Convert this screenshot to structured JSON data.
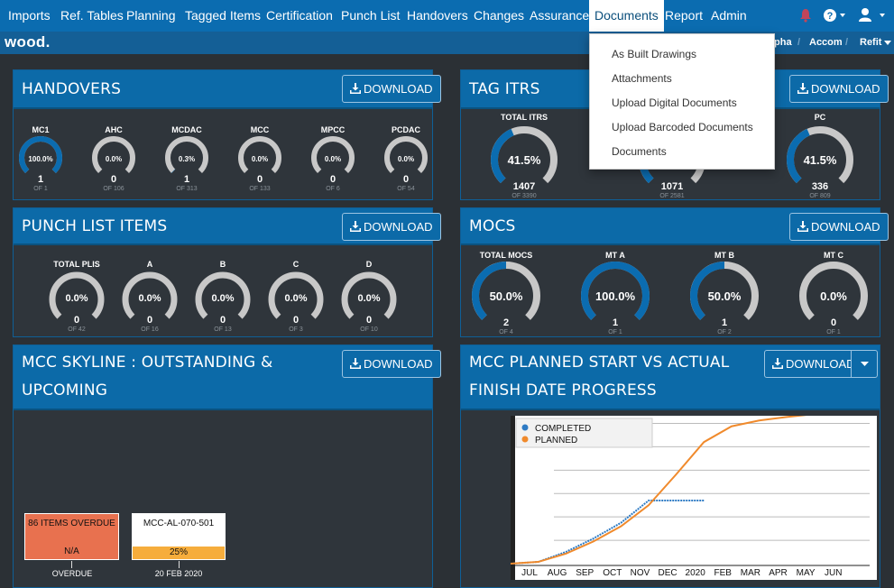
{
  "nav": {
    "items": [
      "Imports",
      "Ref. Tables",
      "Planning",
      "Tagged Items",
      "Certification",
      "Punch List",
      "Handovers",
      "Changes",
      "Assurance",
      "Documents",
      "Report",
      "Admin"
    ],
    "active": "Documents"
  },
  "subbar": {
    "logo": "wood.",
    "crumbs": [
      "pha",
      "Accom",
      "Refit"
    ]
  },
  "dropdown": {
    "items": [
      "As Built Drawings",
      "Attachments",
      "Upload Digital Documents",
      "Upload Barcoded Documents",
      "Documents"
    ]
  },
  "download_label": "DOWNLOAD",
  "panels": {
    "handovers": {
      "title": "HANDOVERS",
      "gauges": [
        {
          "label": "MC1",
          "pct": "100.0%",
          "value": 1.0,
          "count": "1",
          "of": "OF 1"
        },
        {
          "label": "AHC",
          "pct": "0.0%",
          "value": 0,
          "count": "0",
          "of": "OF 106"
        },
        {
          "label": "MCDAC",
          "pct": "0.3%",
          "value": 0.003,
          "count": "1",
          "of": "OF 313"
        },
        {
          "label": "MCC",
          "pct": "0.0%",
          "value": 0,
          "count": "0",
          "of": "OF 133"
        },
        {
          "label": "MPCC",
          "pct": "0.0%",
          "value": 0,
          "count": "0",
          "of": "OF 6"
        },
        {
          "label": "PCDAC",
          "pct": "0.0%",
          "value": 0,
          "count": "0",
          "of": "OF 54"
        }
      ]
    },
    "tag_itrs": {
      "title": "TAG ITRS",
      "gauges": [
        {
          "label": "TOTAL ITRS",
          "pct": "41.5%",
          "value": 0.415,
          "count": "1407",
          "of": "OF 3390"
        },
        {
          "label": "",
          "pct": "",
          "value": 0.415,
          "count": "1071",
          "of": "OF 2581"
        },
        {
          "label": "PC",
          "pct": "41.5%",
          "value": 0.415,
          "count": "336",
          "of": "OF 809"
        }
      ]
    },
    "punch": {
      "title": "PUNCH LIST ITEMS",
      "gauges": [
        {
          "label": "TOTAL PLIS",
          "pct": "0.0%",
          "value": 0,
          "count": "0",
          "of": "OF 42"
        },
        {
          "label": "A",
          "pct": "0.0%",
          "value": 0,
          "count": "0",
          "of": "OF 16"
        },
        {
          "label": "B",
          "pct": "0.0%",
          "value": 0,
          "count": "0",
          "of": "OF 13"
        },
        {
          "label": "C",
          "pct": "0.0%",
          "value": 0,
          "count": "0",
          "of": "OF 3"
        },
        {
          "label": "D",
          "pct": "0.0%",
          "value": 0,
          "count": "0",
          "of": "OF 10"
        }
      ]
    },
    "mocs": {
      "title": "MOCS",
      "gauges": [
        {
          "label": "TOTAL MOCS",
          "pct": "50.0%",
          "value": 0.5,
          "count": "2",
          "of": "OF 4"
        },
        {
          "label": "MT A",
          "pct": "100.0%",
          "value": 1.0,
          "count": "1",
          "of": "OF 1"
        },
        {
          "label": "MT B",
          "pct": "50.0%",
          "value": 0.5,
          "count": "1",
          "of": "OF 2"
        },
        {
          "label": "MT C",
          "pct": "0.0%",
          "value": 0,
          "count": "0",
          "of": "OF 1"
        }
      ]
    },
    "skyline": {
      "title_line1": "MCC SKYLINE : OUTSTANDING &",
      "title_line2": "UPCOMING",
      "cards": [
        {
          "title": "86 ITEMS OVERDUE",
          "footer": "N/A",
          "caption": "OVERDUE"
        },
        {
          "title": "MCC-AL-070-501",
          "footer": "25%",
          "caption": "20 FEB 2020"
        }
      ]
    },
    "progress": {
      "title_line1": "MCC PLANNED START VS ACTUAL",
      "title_line2": "FINISH DATE PROGRESS"
    }
  },
  "colors": {
    "nav_bg": "#0b6cb0",
    "panel_header": "#0c6aa8",
    "gauge_fill": "#0b6cb0",
    "gauge_track": "#c8c8c8",
    "overdue": "#e8714f",
    "upcoming_bar": "#f6ad3c",
    "completed": "#2e7bc4",
    "planned": "#f08a2c"
  },
  "chart_data": {
    "type": "line",
    "legend": "top-left",
    "x": [
      "JUL",
      "AUG",
      "SEP",
      "OCT",
      "NOV",
      "DEC",
      "2020",
      "FEB",
      "MAR",
      "APR",
      "MAY",
      "JUN"
    ],
    "yticks": [
      0,
      200,
      400,
      600,
      800,
      1000,
      1200,
      1400,
      1600,
      1800,
      2000,
      2200,
      2400
    ],
    "ylim": [
      0,
      2500
    ],
    "series": [
      {
        "name": "COMPLETED",
        "values": [
          0,
          30,
          200,
          430,
          700,
          1080,
          1080,
          1080,
          null,
          null,
          null,
          null
        ]
      },
      {
        "name": "PLANNED",
        "values": [
          0,
          30,
          170,
          380,
          640,
          1000,
          1530,
          2080,
          2350,
          2450,
          2510,
          2560
        ]
      }
    ]
  }
}
